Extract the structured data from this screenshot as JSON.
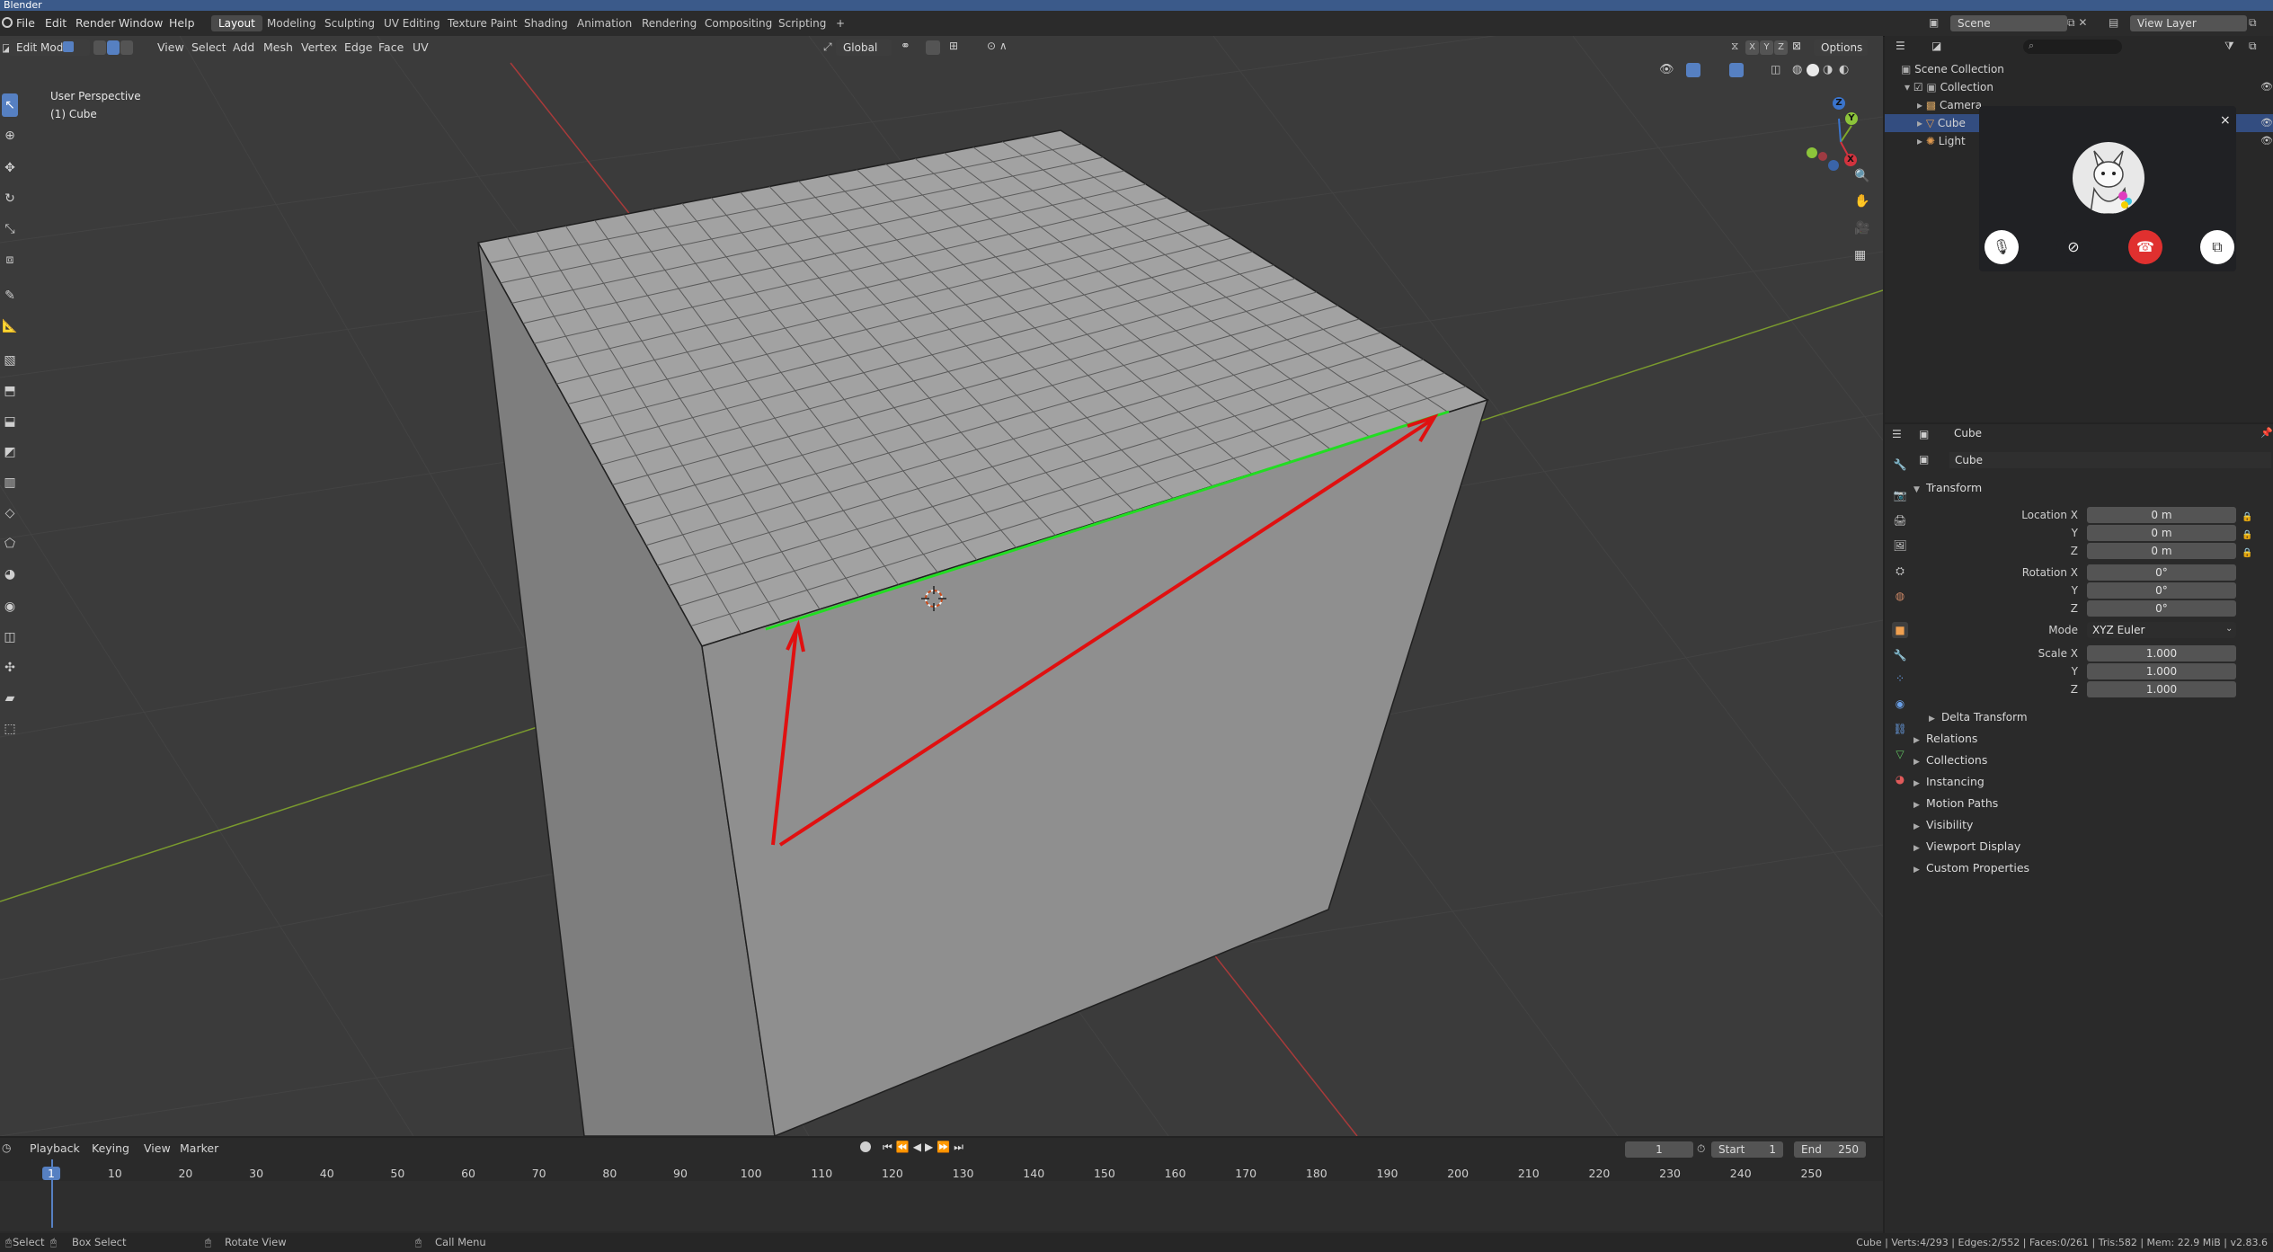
{
  "window": {
    "title": "Blender"
  },
  "menus": [
    "File",
    "Edit",
    "Render",
    "Window",
    "Help"
  ],
  "workspaces": [
    "Layout",
    "Modeling",
    "Sculpting",
    "UV Editing",
    "Texture Paint",
    "Shading",
    "Animation",
    "Rendering",
    "Compositing",
    "Scripting"
  ],
  "active_workspace": "Layout",
  "add_tab": "+",
  "scene": {
    "name": "Scene",
    "view_layer": "View Layer"
  },
  "viewport": {
    "mode": "Edit Mode",
    "menus": [
      "View",
      "Select",
      "Add",
      "Mesh",
      "Vertex",
      "Edge",
      "Face",
      "UV"
    ],
    "transform_orientation": "Global",
    "options_label": "Options",
    "axis_toggles": [
      "X",
      "Y",
      "Z"
    ],
    "info_line1": "User Perspective",
    "info_line2": "(1) Cube",
    "gizmo": {
      "x": "X",
      "y": "Y",
      "z": "Z"
    }
  },
  "outliner": {
    "root": "Scene Collection",
    "collection": "Collection",
    "items": [
      "Camera",
      "Cube",
      "Light"
    ]
  },
  "video_call": {
    "close": "×"
  },
  "properties": {
    "object_name": "Cube",
    "data_name": "Cube",
    "transform_header": "Transform",
    "location_label": "Location X",
    "location": [
      "0 m",
      "0 m",
      "0 m"
    ],
    "rotation_label": "Rotation X",
    "rotation": [
      "0°",
      "0°",
      "0°"
    ],
    "mode_label": "Mode",
    "mode_value": "XYZ Euler",
    "scale_label": "Scale X",
    "scale": [
      "1.000",
      "1.000",
      "1.000"
    ],
    "axis_y": "Y",
    "axis_z": "Z",
    "delta": "Delta Transform",
    "panels": [
      "Relations",
      "Collections",
      "Instancing",
      "Motion Paths",
      "Visibility",
      "Viewport Display",
      "Custom Properties"
    ]
  },
  "timeline": {
    "menus": [
      "Playback",
      "Keying",
      "View",
      "Marker"
    ],
    "current_frame": "1",
    "start_label": "Start",
    "start": "1",
    "end_label": "End",
    "end": "250",
    "ticks": [
      "1",
      "10",
      "20",
      "30",
      "40",
      "50",
      "60",
      "70",
      "80",
      "90",
      "100",
      "110",
      "120",
      "130",
      "140",
      "150",
      "160",
      "170",
      "180",
      "190",
      "200",
      "210",
      "220",
      "230",
      "240",
      "250"
    ]
  },
  "statusbar": {
    "select": "Select",
    "box_select": "Box Select",
    "rotate": "Rotate View",
    "call_menu": "Call Menu",
    "stats": "Cube | Verts:4/293 | Edges:2/552 | Faces:0/261 | Tris:582 | Mem: 22.9 MiB | v2.83.6"
  },
  "colors": {
    "accent": "#5680c2",
    "selected_edge": "#22dd22",
    "annotation": "#e01010",
    "hangup": "#e0302f"
  }
}
